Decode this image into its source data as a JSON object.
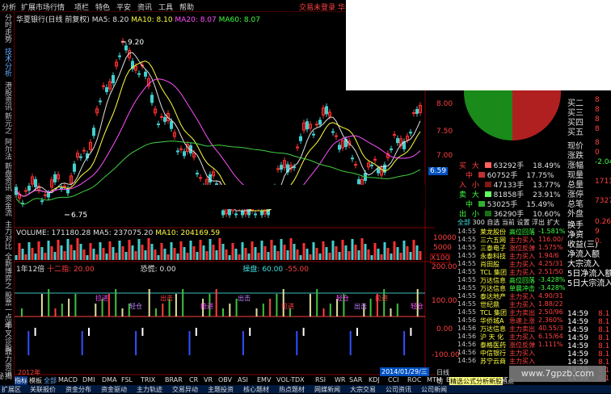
{
  "menu": {
    "items": [
      "分析",
      "扩展市场行情",
      "项栏",
      "特色",
      "平安",
      "资讯",
      "工具",
      "帮助"
    ],
    "trade_status": "交易未登录",
    "trade_extra": "华"
  },
  "sidebar": {
    "tabs": [
      "分时走势",
      "技术分析",
      "港股资讯",
      "新元之",
      "阿尔法",
      "新盘资讯",
      "资金流",
      "主力对比",
      "全新博弈之",
      "股票一点通",
      "牛叉诊股",
      "鼎力资讯",
      "揭秘资讯"
    ]
  },
  "chart_title": {
    "name": "华夏银行(日线 前复权)",
    "ma5": "MA5: 8.20",
    "ma10": "MA10: 8.10",
    "ma20": "MA20: 8.07",
    "ma60": "MA60: 8.07"
  },
  "price_annotations": {
    "high": "9.20",
    "low": "6.75"
  },
  "price_axis": [
    "8.00",
    "7.50",
    "7.00",
    "6.59"
  ],
  "volume": {
    "label": "VOLUME: 171180.28",
    "ma5": "MA5: 237075.20",
    "ma10": "MA10: 204169.59",
    "axis": [
      "10000",
      "5000",
      "X100"
    ]
  },
  "indicator": {
    "label": "1年12倍",
    "sub1": "十二指: 20.00",
    "sub2": "恐慌: 0.00",
    "sub3": "操盘: 60.00",
    "sub4": "-55.00",
    "axis": [
      "200.00",
      "100.00",
      "0.00",
      "-100.00"
    ],
    "signals": [
      "拉进",
      "轻仓",
      "出击",
      "抢进",
      "出击",
      "拉进",
      "轻仓",
      "出击",
      "拉进",
      "轻仓"
    ]
  },
  "date_axis": {
    "left": "2012年",
    "cursor": "2014/01/29/三"
  },
  "order_book": {
    "sell": [
      {
        "side": "买",
        "kind": "大",
        "vol": "63292手",
        "pct": "18.49%"
      },
      {
        "side": "",
        "kind": "中",
        "vol": "60752手",
        "pct": "17.75%"
      },
      {
        "side": "入",
        "kind": "小",
        "vol": "47133手",
        "pct": "13.77%"
      }
    ],
    "buy": [
      {
        "side": "卖",
        "kind": "大",
        "vol": "81858手",
        "pct": "23.91%"
      },
      {
        "side": "",
        "kind": "中",
        "vol": "53025手",
        "pct": "15.49%"
      },
      {
        "side": "出",
        "kind": "小",
        "vol": "36290手",
        "pct": "10.60%"
      }
    ]
  },
  "quote_labels": [
    "买二",
    "买三",
    "买四",
    "买五",
    "现价",
    "涨跌",
    "涨幅",
    "现量",
    "总量",
    "涨停",
    "总笔",
    "外盘",
    "换手",
    "净资",
    "收益(三)",
    "净流入额",
    "大宗流入",
    "5日净流入额",
    "5日大宗流入"
  ],
  "quote_values": [
    "8",
    "8",
    "8",
    "8",
    "8",
    "0",
    "-2.04",
    "",
    "17118",
    "",
    "7327",
    "",
    "0.26",
    "9",
    "0.",
    "",
    "",
    "",
    ""
  ],
  "flow_tabs": [
    "全部",
    "300",
    "自选",
    "当前",
    "设置",
    "浮出",
    "扩大"
  ],
  "flow_rows": [
    {
      "time": "14:55",
      "name": "莱龙股份",
      "type": "高位回落",
      "val": "-1.581%"
    },
    {
      "time": "14:55",
      "name": "三六五网",
      "type": "主力买入",
      "val": "116.00/"
    },
    {
      "time": "14:55",
      "name": "三泰电子",
      "type": "涨位反弹",
      "val": "1.575%"
    },
    {
      "time": "14:55",
      "name": "永泰科技",
      "type": "主力买入",
      "val": "1.94/6"
    },
    {
      "time": "14:55",
      "name": "肖田股",
      "type": "主力买入",
      "val": "4.25/31"
    },
    {
      "time": "14:55",
      "name": "TCL 集团",
      "type": "主力买入",
      "val": "2.51/50"
    },
    {
      "time": "14:55",
      "name": "万达信息",
      "type": "高位回落",
      "val": "-3.428%"
    },
    {
      "time": "14:55",
      "name": "万达信息",
      "type": "单晨冲击",
      "val": "-3.428%"
    },
    {
      "time": "14:55",
      "name": "泰达地产",
      "type": "主力买入",
      "val": "4.90/31"
    },
    {
      "time": "14:55",
      "name": "世纪鼎",
      "type": "主力买入",
      "val": "1.88/22"
    },
    {
      "time": "14:55",
      "name": "TCL 集团",
      "type": "主力卖出",
      "val": "2.50/96"
    },
    {
      "time": "14:56",
      "name": "华侨城A",
      "type": "急速上涨",
      "val": "2.360%"
    },
    {
      "time": "14:56",
      "name": "万达信息",
      "type": "主力卖出",
      "val": "40.55/3"
    },
    {
      "time": "14:56",
      "name": "沪 天 化",
      "type": "主力买入",
      "val": "6.15/64"
    },
    {
      "time": "14:56",
      "name": "泰格医药",
      "type": "涨位反弹",
      "val": "1.111%"
    },
    {
      "time": "14:56",
      "name": "中信银行",
      "type": "主力买入",
      "val": ""
    },
    {
      "time": "14:56",
      "name": "苏宁云商",
      "type": "主力买入",
      "val": ""
    }
  ],
  "time_col": [
    "14:59",
    "14:59",
    "14:59",
    "14:59",
    "14:59",
    "14:59",
    "14:59",
    "14:59",
    "14:59"
  ],
  "time_col_vals": [
    "8.1",
    "8.1",
    "8.1",
    "8.1",
    "8.1",
    "8.1",
    "8.1",
    "8.1",
    "8.1"
  ],
  "bottom_tabs": [
    "指标",
    "模板",
    "全部",
    "MACD",
    "DMI",
    "DMA",
    "FSL",
    "TRIX",
    "BRAR",
    "CR",
    "VR",
    "OBV",
    "ASI",
    "EMV",
    "VOL-TDX",
    "RSI",
    "WR",
    "SAR",
    "KDJ",
    "CCI",
    "ROC",
    "MTM",
    "BOLL",
    "PSY",
    "MCST"
  ],
  "right_tabs": [
    "日线",
    "切",
    "精选公式分析新股",
    "热点"
  ],
  "bottom_bar": [
    "扩展区",
    "关联报价",
    "资金分布",
    "资金驱动",
    "主力轨迹",
    "交易异动",
    "主题投资",
    "核心题材",
    "热点题材",
    "网媒新闻",
    "大宗交易",
    "公司资讯",
    "公司新闻"
  ],
  "watermark": "www.7gpzb.com",
  "colors": {
    "up": "#ff3030",
    "down": "#40d0d0",
    "accent_sell": "#ff4040",
    "accent_buy": "#40ff40",
    "pie_red": "#b02020",
    "pie_green": "#1a8a1a"
  }
}
